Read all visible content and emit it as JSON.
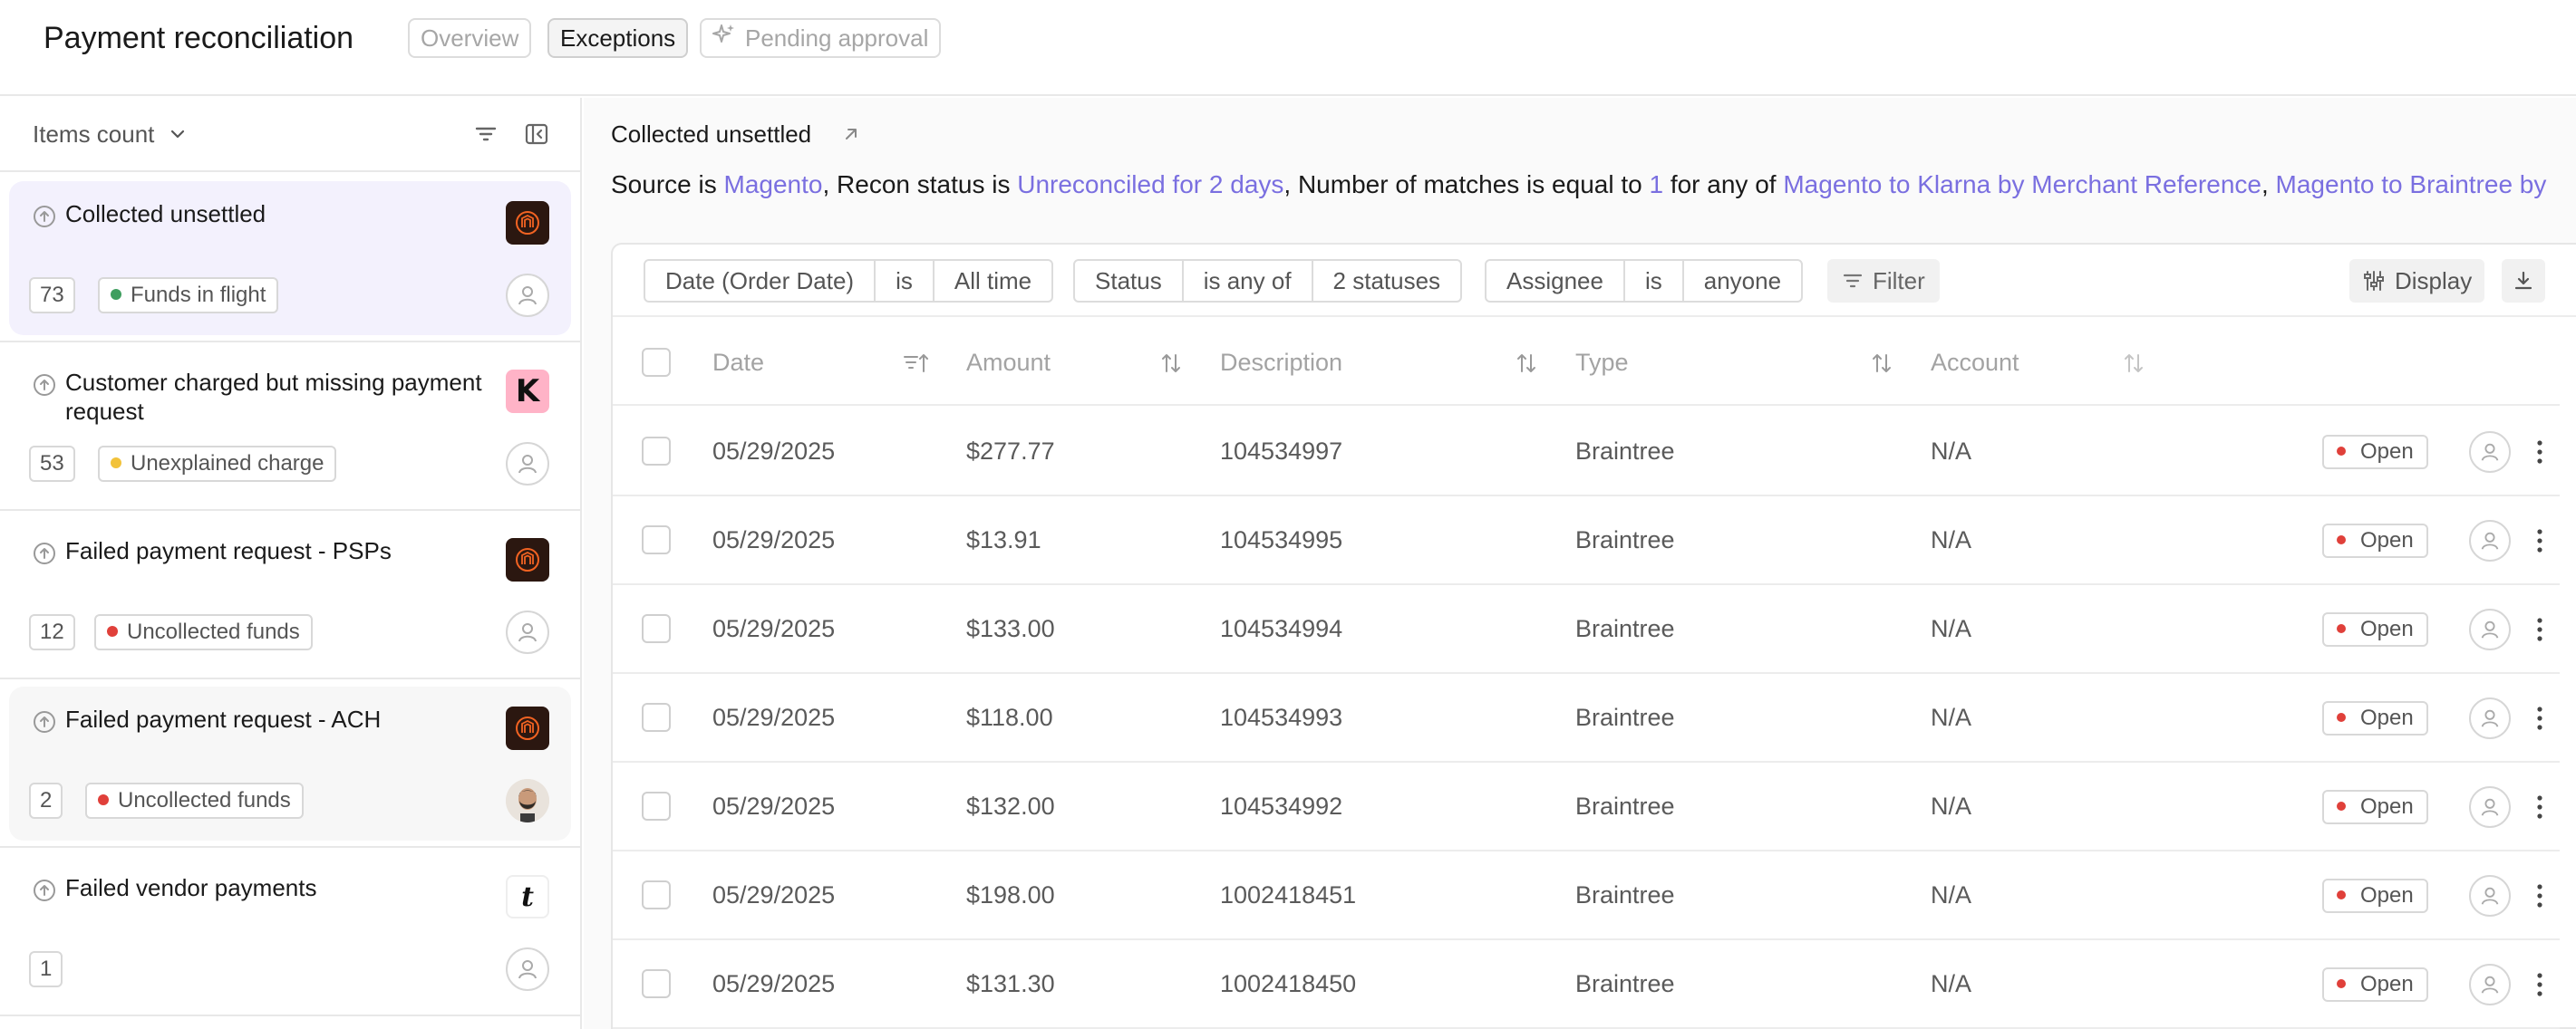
{
  "header": {
    "title": "Payment reconciliation",
    "tabs": [
      {
        "label": "Overview",
        "active": false
      },
      {
        "label": "Exceptions",
        "active": true
      },
      {
        "label": "Pending approval",
        "active": false,
        "icon": "sparkle-icon"
      }
    ]
  },
  "sidebar": {
    "items_count_label": "Items count",
    "categories": [
      {
        "title": "Collected unsettled",
        "count": "73",
        "tag": "Funds in flight",
        "tag_color": "#3f9e5f",
        "logo": "magento-logo",
        "assignee": "unassigned",
        "selected": true
      },
      {
        "title": "Customer charged but missing payment request",
        "count": "53",
        "tag": "Unexplained charge",
        "tag_color": "#f2c23a",
        "logo": "klarna-logo",
        "logo_text": "K",
        "assignee": "unassigned"
      },
      {
        "title": "Failed payment request - PSPs",
        "count": "12",
        "tag": "Uncollected funds",
        "tag_color": "#e0403a",
        "logo": "magento-logo",
        "assignee": "unassigned"
      },
      {
        "title": "Failed payment request - ACH",
        "count": "2",
        "tag": "Uncollected funds",
        "tag_color": "#e0403a",
        "logo": "magento-logo",
        "assignee": "user-photo"
      },
      {
        "title": "Failed vendor payments",
        "count": "1",
        "tag": "",
        "logo": "tipalti-logo",
        "logo_text": "t",
        "assignee": "unassigned"
      }
    ]
  },
  "main": {
    "title": "Collected unsettled",
    "criteria": {
      "t1": "Source is ",
      "v1": "Magento",
      "t2": ", Recon status is ",
      "v2": "Unreconciled for 2 days",
      "t3": ", Number of matches is equal to ",
      "v3": "1",
      "t4": " for any of ",
      "v4": "Magento to Klarna by Merchant Reference",
      "t5": ", ",
      "v5": "Magento to Braintree by"
    },
    "filters": [
      {
        "field": "Date (Order Date)",
        "op": "is",
        "value": "All time"
      },
      {
        "field": "Status",
        "op": "is any of",
        "value": "2 statuses"
      },
      {
        "field": "Assignee",
        "op": "is",
        "value": "anyone"
      }
    ],
    "filter_label": "Filter",
    "display_label": "Display",
    "columns": [
      "Date",
      "Amount",
      "Description",
      "Type",
      "Account"
    ],
    "status_color": "#e0403a",
    "rows": [
      {
        "date": "05/29/2025",
        "amount": "$277.77",
        "description": "104534997",
        "type": "Braintree",
        "account": "N/A",
        "status": "Open"
      },
      {
        "date": "05/29/2025",
        "amount": "$13.91",
        "description": "104534995",
        "type": "Braintree",
        "account": "N/A",
        "status": "Open"
      },
      {
        "date": "05/29/2025",
        "amount": "$133.00",
        "description": "104534994",
        "type": "Braintree",
        "account": "N/A",
        "status": "Open"
      },
      {
        "date": "05/29/2025",
        "amount": "$118.00",
        "description": "104534993",
        "type": "Braintree",
        "account": "N/A",
        "status": "Open"
      },
      {
        "date": "05/29/2025",
        "amount": "$132.00",
        "description": "104534992",
        "type": "Braintree",
        "account": "N/A",
        "status": "Open"
      },
      {
        "date": "05/29/2025",
        "amount": "$198.00",
        "description": "1002418451",
        "type": "Braintree",
        "account": "N/A",
        "status": "Open"
      },
      {
        "date": "05/29/2025",
        "amount": "$131.30",
        "description": "1002418450",
        "type": "Braintree",
        "account": "N/A",
        "status": "Open"
      }
    ]
  },
  "colors": {
    "accent": "#7a6fe0",
    "selected_bg": "#f3f1fd"
  }
}
